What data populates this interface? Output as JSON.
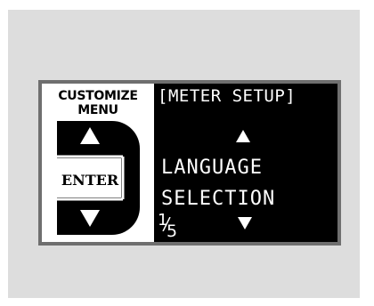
{
  "menu": {
    "title_line1": "CUSTOMIZE",
    "title_line2": "MENU",
    "enter_label": "ENTER",
    "up_icon": "triangle-up-icon",
    "down_icon": "triangle-down-icon"
  },
  "screen": {
    "title": "[METER SETUP]",
    "item_line1": "LANGUAGE",
    "item_line2": "SELECTION",
    "page_current": "1",
    "page_total": "5",
    "up_arrow_icon": "up-arrow-icon",
    "down_arrow_icon": "down-arrow-icon"
  },
  "colors": {
    "panel_background": "#dddddd",
    "display_frame": "#6f6f6f",
    "lcd_background": "#000000",
    "lcd_text": "#ffffff"
  }
}
